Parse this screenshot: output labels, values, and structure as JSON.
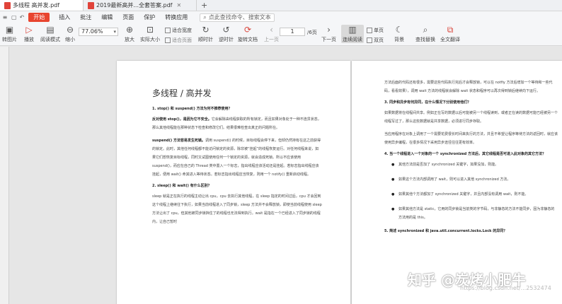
{
  "tabs": [
    {
      "label": "多线程 高并发.pdf",
      "active": true
    },
    {
      "label": "2019最新高并...全套答案.pdf",
      "active": false
    }
  ],
  "tab_add": "+",
  "menu": {
    "start": "开始",
    "items": [
      "插入",
      "批注",
      "编辑",
      "页面",
      "保护",
      "转换应用"
    ],
    "search_placeholder": "点此查找命令、搜索文本"
  },
  "toolbar": {
    "to_image": "转图片",
    "play": "播放",
    "read_mode": "阅读模式",
    "zoom_out": "缩小",
    "zoom_value": "77.06%",
    "zoom_in": "放大",
    "actual_size": "实际大小",
    "fit_width": "适合宽度",
    "fit_page": "适合页面",
    "rotate_cw": "顺时针",
    "rotate_ccw": "逆时针",
    "rotate_doc": "旋转文档",
    "prev_page": "上一页",
    "page_value": "1",
    "page_total": "/6页",
    "next_page": "下一页",
    "continuous": "连续阅读",
    "single_page": "单页",
    "two_page": "双页",
    "background": "背景",
    "find_replace": "查找替换",
    "translate": "全文翻译"
  },
  "left_page": {
    "title": "多线程 / 高并发",
    "q1": "1. stop() 和 suspend() 方法为何不推荐使用？",
    "p1_bold": "反对使用 stop()，是因为它不安全。",
    "p1": "它会解除由线程获取的所有锁定，而且如果对象处于一种不连贯状态，那么其他线程能在那种状态下检查和修改它们。结果很难检查出真正的问题所在。",
    "p2_bold": "suspend() 方法容易发生死锁。",
    "p2": "调用 suspend() 的时候，目标线程会停下来，但却仍然持有在这之前获得的锁定。此时，其他任何线程都不能访问锁定的资源，除非被“挂起”的线程恢复运行。对任何线程来说，如果它们想恢复目标线程，同时又试图使用任何一个锁定的资源，就会造成死锁。所以不应该使用 suspend()，而应在自己的 Thread 类中置入一个标志，指出线程应该活动还是挂起。若标志指出线程应该挂起，便用 wait() 命其进入等待状态。若标志指出线程应当恢复，则用一个 notify() 重新启动线程。",
    "q2": "2. sleep() 和 wait() 有什么区别？",
    "p3": "sleep 就是正在执行的线程主动让出 cpu，cpu 去执行其他线程，在 sleep 指定的时间过后，cpu 才会回到这个线程上继续往下执行，如果当前线程进入了同步锁，sleep 方法并不会释放锁，即使当前线程使用 sleep 方法让出了 cpu，但其他被同步锁挡住了的线程也无法得到执行。wait 是指在一个已经进入了同步锁的线程内，让自己暂时"
  },
  "right_page": {
    "p1": "方法后面的代码还有很多，需要这些代码执行完后才会释放锁，可以在 notfiy 方法后增加一个等待和一些代码，看看效果），调用 wait 方法的线程就会解除 wait 状态和程序可以再次得到锁后继续向下运行。",
    "q3": "3. 同步和异步有何异同，在什么情况下分别使用他们？",
    "p2": "如果数据将在线程间共享。例如正在写的数据以后可能被另一个线程读到，或者正在读的数据可能已经被另一个线程写过了，那么这些数据就是共享数据，必须进行同步存取。",
    "p3": "当应用程序在对象上调用了一个需要花费很长时间来执行的方法，并且不希望让程序等待方法的返回时，就应该使用异步编程，在很多情况下采用异步途径往往更有效率。",
    "q4": "4. 当一个线程进入一个对象的一个 synchronized 方法后，其它线程是否可进入此对象的其它方法？",
    "bullets": [
      "其他方法前是否加了 synchronized 关键字，如果没加，则能。",
      "如果这个方法内部调用了 wait，则可以进入其他 synchronized 方法。",
      "如果其他个方法都加了 synchronized 关键字，并且内部没有调用 wait，则不能。",
      "如果其他方法是 static，它用的同步锁是当前类的字节码，与非静态的方法不能同步，因为非静态的方法用的是 this。"
    ],
    "q5": "5. 简述 synchronized 和 java.util.concurrent.locks.Lock 的异同？"
  },
  "watermark": "知乎 @炭烤小肥牛",
  "watermark_url": "https://blog.csdn.net/...2532474",
  "colors": {
    "accent": "#e8452f",
    "pdf_icon": "#e0433a"
  }
}
